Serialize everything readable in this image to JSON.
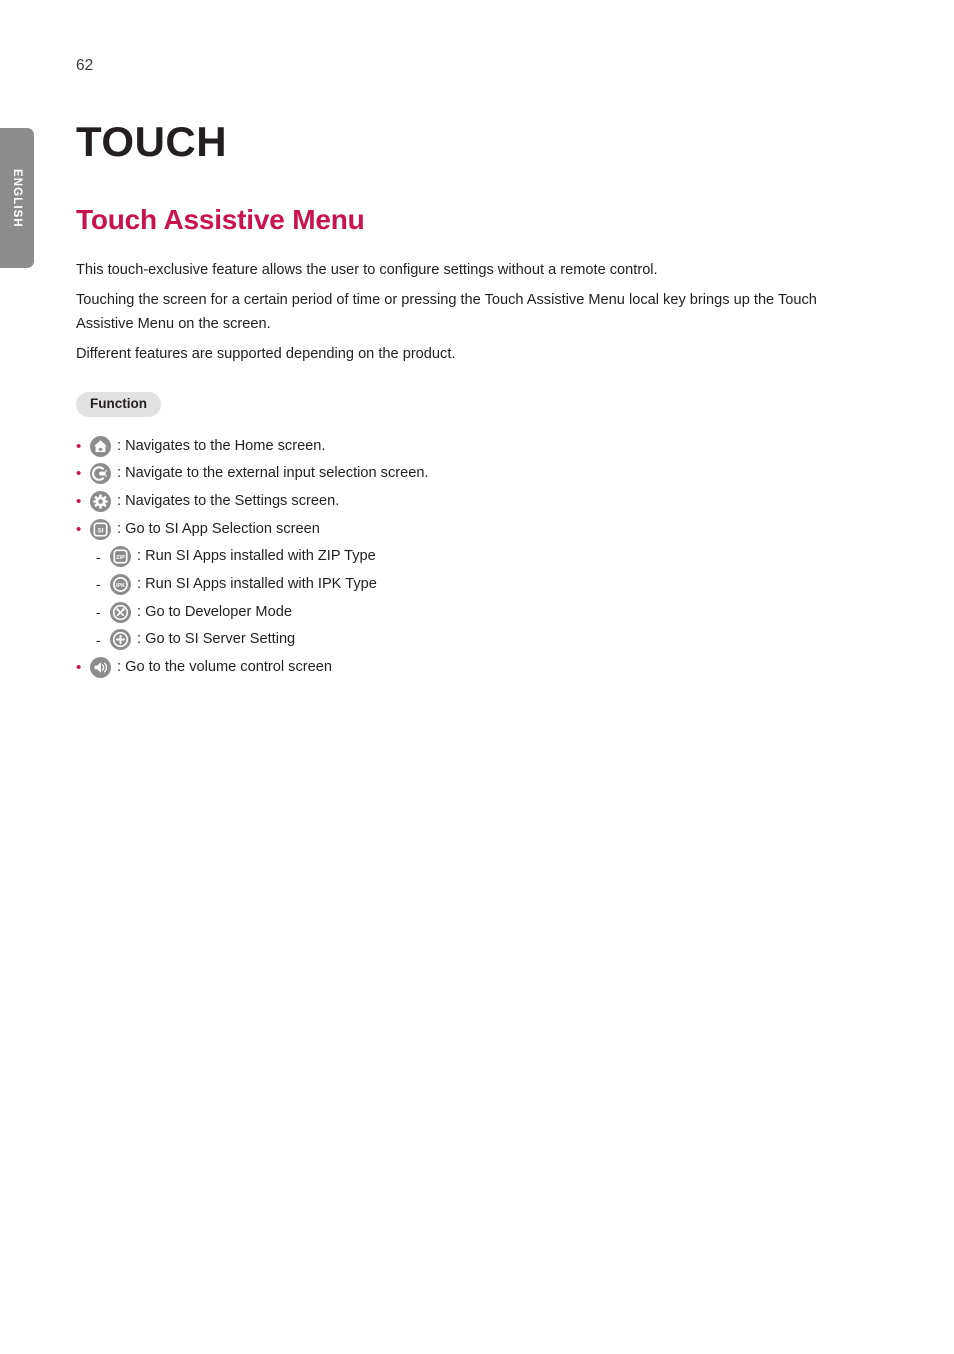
{
  "sidebar": {
    "language_tab": "ENGLISH"
  },
  "page": {
    "page_number": "62",
    "chapter_title": "TOUCH",
    "section_title": "Touch Assistive Menu",
    "paragraphs": [
      "This touch-exclusive feature allows the user to configure settings without a remote control.",
      "Touching the screen for a certain period of time or pressing the Touch Assistive Menu local key brings up the Touch Assistive Menu on the screen.",
      "Different features are supported depending on the product."
    ],
    "badge_label": "Function",
    "function_items": [
      {
        "level": "top",
        "marker": "•",
        "icon": "home-icon",
        "text": ": Navigates to the Home screen."
      },
      {
        "level": "top",
        "marker": "•",
        "icon": "input-plug-icon",
        "text": ": Navigate to the external input selection screen."
      },
      {
        "level": "top",
        "marker": "•",
        "icon": "gear-icon",
        "text": ": Navigates to the Settings screen."
      },
      {
        "level": "top",
        "marker": "•",
        "icon": "si-badge-icon",
        "text": ": Go to SI App Selection screen"
      },
      {
        "level": "sub",
        "marker": "-",
        "icon": "zip-badge-icon",
        "text": ": Run SI Apps installed with ZIP Type"
      },
      {
        "level": "sub",
        "marker": "-",
        "icon": "ipk-badge-icon",
        "text": ": Run SI Apps installed with IPK Type"
      },
      {
        "level": "sub",
        "marker": "-",
        "icon": "developer-tools-icon",
        "text": ": Go to Developer Mode"
      },
      {
        "level": "sub",
        "marker": "-",
        "icon": "plus-icon",
        "text": ": Go to SI Server Setting"
      },
      {
        "level": "top",
        "marker": "•",
        "icon": "speaker-volume-icon",
        "text": ": Go to the volume control screen"
      }
    ],
    "icon_labels": {
      "si": "SI",
      "zip": "ZIP",
      "ipk": "IPK"
    }
  },
  "colors": {
    "accent": "#c8134f",
    "text": "#231f20",
    "icon_gray": "#8c8c8c",
    "badge_bg": "#e2e2e2",
    "tab_bg": "#8c8c8c"
  }
}
